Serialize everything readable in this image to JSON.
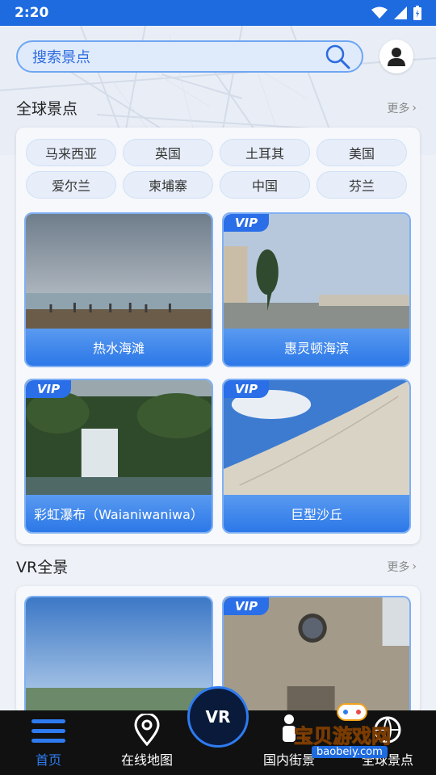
{
  "status": {
    "time": "2:20"
  },
  "search": {
    "placeholder": "搜索景点"
  },
  "global": {
    "title": "全球景点",
    "more": "更多",
    "countries": [
      "马来西亚",
      "英国",
      "土耳其",
      "美国",
      "爱尔兰",
      "柬埔寨",
      "中国",
      "芬兰"
    ],
    "spots": [
      {
        "name": "热水海滩",
        "vip": false
      },
      {
        "name": "惠灵顿海滨",
        "vip": true
      },
      {
        "name": "彩虹瀑布（Waianiwaniwa）",
        "vip": true
      },
      {
        "name": "巨型沙丘",
        "vip": true
      }
    ],
    "vip_badge": "VIP"
  },
  "vr": {
    "title": "VR全景",
    "more": "更多",
    "vip_badge": "VIP"
  },
  "tabs": {
    "home": "首页",
    "map": "在线地图",
    "vr": "VR",
    "domestic": "国内街景",
    "global": "全球景点"
  },
  "watermark": {
    "title": "宝贝游戏网",
    "url": "baobeiy.com"
  }
}
